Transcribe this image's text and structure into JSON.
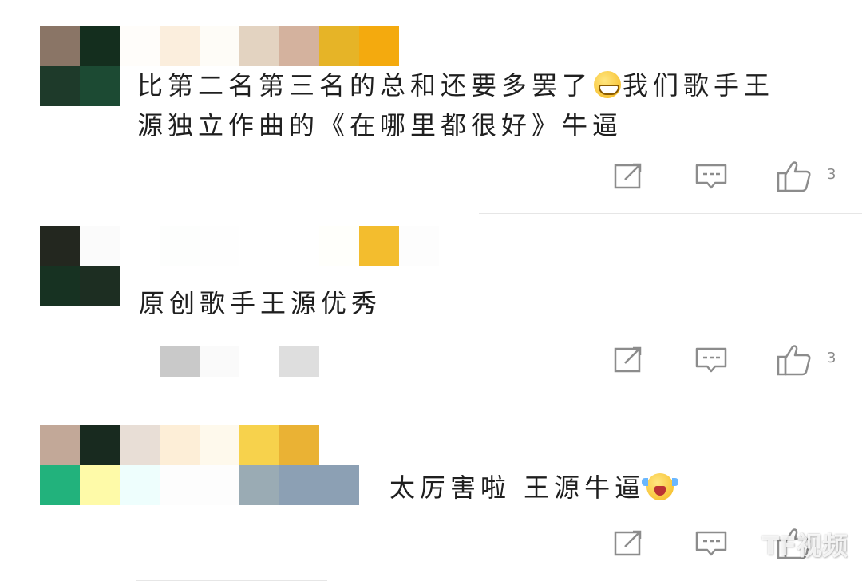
{
  "comments": [
    {
      "text_line1": "比第二名第三名的总和还要多罢了",
      "text_line1_after": "我们歌手王",
      "text_line2": "源独立作曲的《在哪里都很好》牛逼",
      "emoji": "grinning-face-icon",
      "like_count": "3"
    },
    {
      "text_line1": "原创歌手王源优秀",
      "like_count": "3"
    },
    {
      "text_line1": "太厉害啦 王源牛逼",
      "emoji": "loudly-laughing-face-icon"
    }
  ],
  "watermark": "TF视频",
  "colors": {
    "icon_gray": "#8c8c8c",
    "text": "#1f1f1f",
    "divider": "#e6e6e6"
  }
}
